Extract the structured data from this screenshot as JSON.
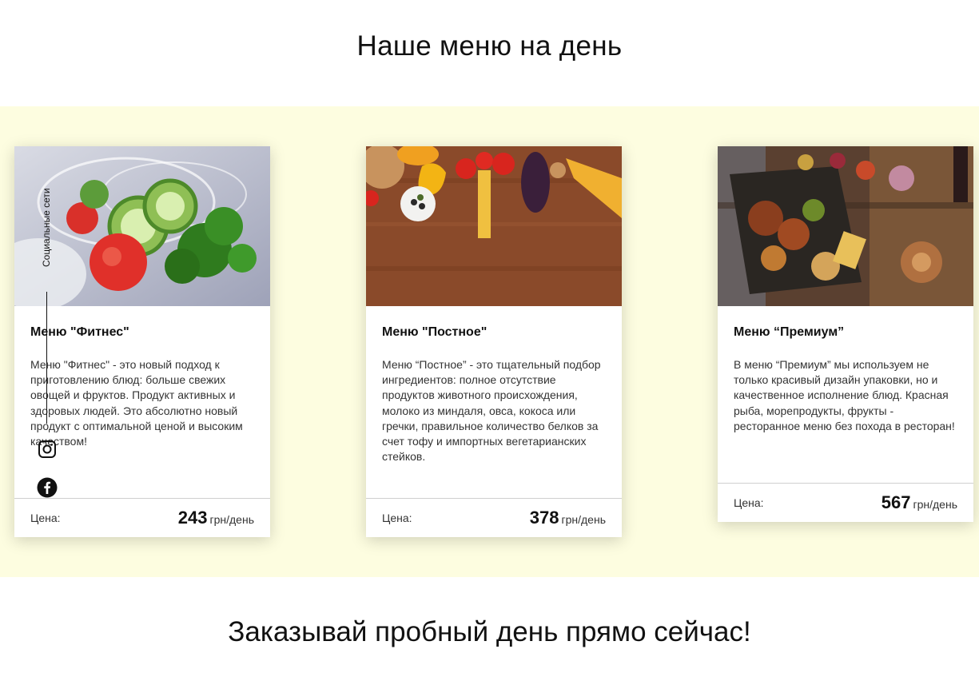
{
  "page": {
    "title": "Наше меню на день",
    "cta": "Заказывай пробный день прямо сейчас!"
  },
  "colors": {
    "band": "#fdfde0",
    "card": "#ffffff",
    "divider": "#cfcfcf"
  },
  "social": {
    "label": "Социальные сети",
    "icons": [
      "instagram-icon",
      "facebook-icon"
    ]
  },
  "cards": [
    {
      "name": "Меню \"Фитнес\"",
      "description": "Меню \"Фитнес\" - это новый подход к приготовлению блюд: больше свежих овощей и фруктов. Продукт активных и здоровых людей. Это абсолютно новый продукт с оптимальной ценой и высоким качеством!",
      "price_label": "Цена:",
      "price": "243",
      "unit": "грн/день",
      "image": "salad-photo"
    },
    {
      "name": "Меню \"Постное\"",
      "description": "Меню “Постное” - это тщательный подбор ингредиентов: полное отсутствие продуктов животного происхождения, молоко из миндаля, овса, кокоса или гречки, правильное количество белков за счет тофу и импортных вегетарианских стейков.",
      "price_label": "Цена:",
      "price": "378",
      "unit": "грн/день",
      "image": "vegetables-photo"
    },
    {
      "name": "Меню “Премиум”",
      "description": "В меню “Премиум” мы используем не только красивый дизайн упаковки, но и качественное исполнение блюд. Красная рыба, морепродукты, фрукты - ресторанное меню без похода в ресторан!",
      "price_label": "Цена:",
      "price": "567",
      "unit": "грн/день",
      "image": "feast-photo"
    }
  ]
}
